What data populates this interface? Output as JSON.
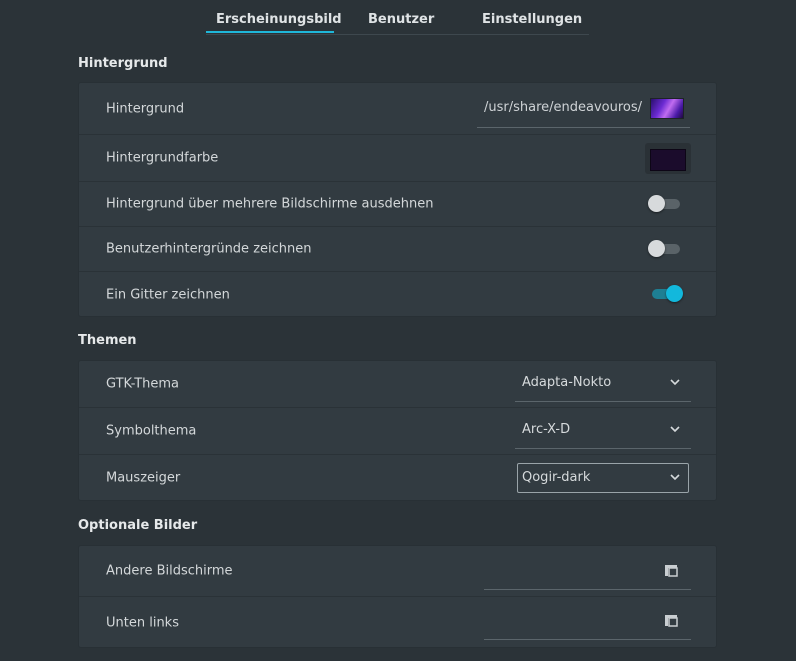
{
  "tabs": [
    {
      "label": "Erscheinungsbild",
      "active": true
    },
    {
      "label": "Benutzer",
      "active": false
    },
    {
      "label": "Einstellungen",
      "active": false
    }
  ],
  "sections": {
    "background": {
      "title": "Hintergrund",
      "rows": {
        "wallpaper": {
          "label": "Hintergrund",
          "value": "/usr/share/endeavouros/"
        },
        "bgcolor": {
          "label": "Hintergrundfarbe",
          "color": "#1b0c2c"
        },
        "span": {
          "label": "Hintergrund über mehrere Bildschirme ausdehnen",
          "enabled": false
        },
        "userbg": {
          "label": "Benutzerhintergründe zeichnen",
          "enabled": false
        },
        "grid": {
          "label": "Ein Gitter zeichnen",
          "enabled": true
        }
      }
    },
    "themes": {
      "title": "Themen",
      "rows": {
        "gtk": {
          "label": "GTK-Thema",
          "value": "Adapta-Nokto"
        },
        "icons": {
          "label": "Symbolthema",
          "value": "Arc-X-D"
        },
        "cursor": {
          "label": "Mauszeiger",
          "value": "Qogir-dark"
        }
      }
    },
    "optional": {
      "title": "Optionale Bilder",
      "rows": {
        "other": {
          "label": "Andere Bildschirme",
          "value": ""
        },
        "bottomleft": {
          "label": "Unten links",
          "value": ""
        }
      }
    }
  },
  "colors": {
    "accent": "#1fb7d9",
    "background": "#2b3338",
    "card": "#323b41"
  }
}
